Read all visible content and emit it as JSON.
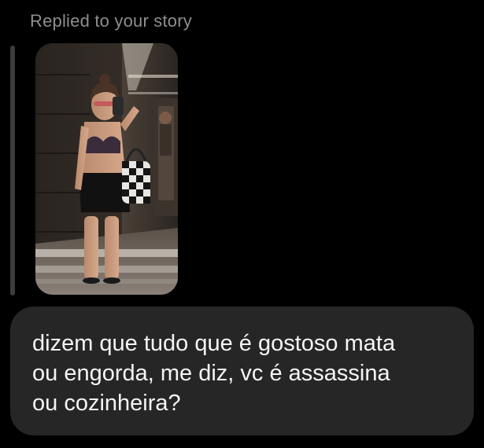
{
  "reply": {
    "label": "Replied to your story"
  },
  "story": {
    "media": "mirror-selfie-photo"
  },
  "message": {
    "text": "dizem que tudo que é gostoso mata\nou engorda, me diz, vc é assassina\nou cozinheira?"
  },
  "colors": {
    "background": "#000000",
    "label": "#8e8e8e",
    "bubble": "#262626",
    "message_text": "#f5f5f5",
    "quote_bar": "#3c3c3c"
  }
}
